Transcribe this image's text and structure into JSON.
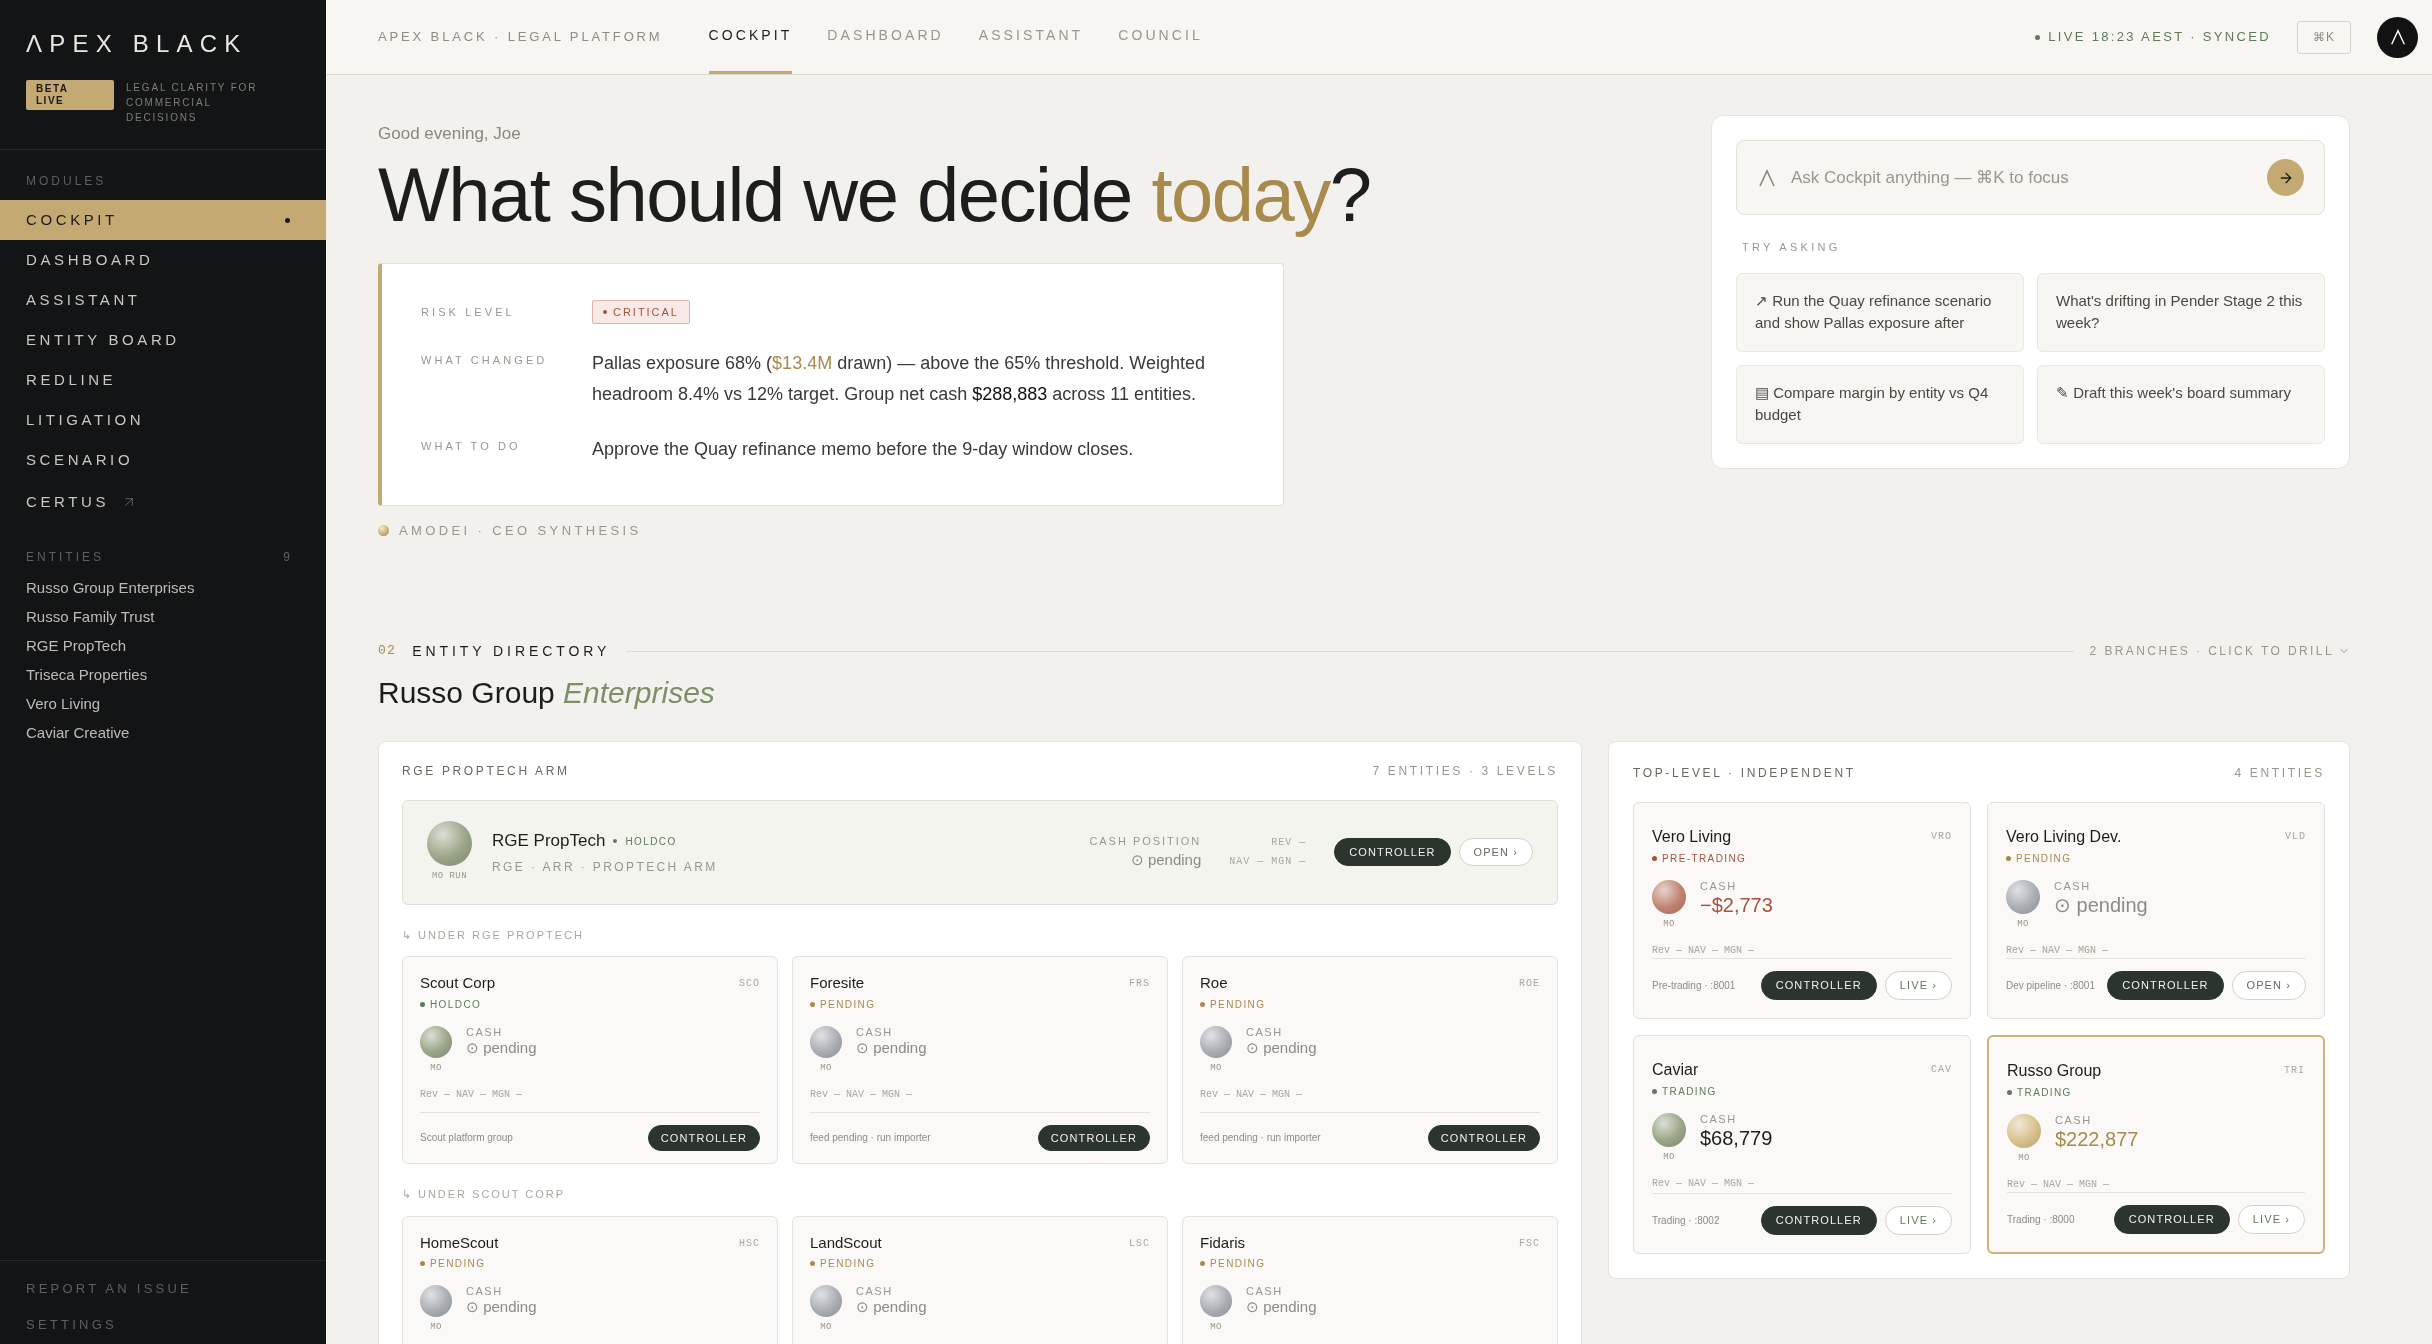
{
  "sidebar": {
    "logo": "ΛPEX BLACK",
    "badge": "BETA LIVE",
    "tagline": "LEGAL CLARITY FOR COMMERCIAL DECISIONS",
    "modules_label": "MODULES",
    "modules": [
      {
        "label": "COCKPIT",
        "selected": true,
        "external": false
      },
      {
        "label": "DASHBOARD",
        "selected": false,
        "external": false
      },
      {
        "label": "ASSISTANT",
        "selected": false,
        "external": false
      },
      {
        "label": "ENTITY BOARD",
        "selected": false,
        "external": false
      },
      {
        "label": "REDLINE",
        "selected": false,
        "external": false
      },
      {
        "label": "LITIGATION",
        "selected": false,
        "external": false
      },
      {
        "label": "SCENARIO",
        "selected": false,
        "external": false
      },
      {
        "label": "CERTUS",
        "selected": false,
        "external": true
      }
    ],
    "entities_label": "ENTITIES",
    "entities_count": "9",
    "entities": [
      "Russo Group Enterprises",
      "Russo Family Trust",
      "RGE PropTech",
      "Triseca Properties",
      "Vero Living",
      "Caviar Creative"
    ],
    "footer": [
      "REPORT AN ISSUE",
      "SETTINGS"
    ]
  },
  "topbar": {
    "crumb": "APEX BLACK · LEGAL PLATFORM",
    "tabs": [
      {
        "label": "COCKPIT",
        "selected": true
      },
      {
        "label": "DASHBOARD",
        "selected": false
      },
      {
        "label": "ASSISTANT",
        "selected": false
      },
      {
        "label": "COUNCIL",
        "selected": false
      }
    ],
    "status": "LIVE 18:23 AEST · SYNCED",
    "shortcut": "⌘K"
  },
  "hero": {
    "greeting": "Good evening, Joe",
    "title": "What should we decide ",
    "title_highlight": "today",
    "title_end": "?",
    "brief": [
      {
        "kind": "badge",
        "label": "RISK LEVEL",
        "badge": "CRITICAL"
      },
      {
        "kind": "text",
        "label": "WHAT CHANGED",
        "segments": [
          {
            "text": "Pallas exposure 68% (",
            "kind": "plain"
          },
          {
            "text": "$13.4M",
            "kind": "gold"
          },
          {
            "text": " drawn) — above the 65% threshold. Weighted headroom 8.4% vs 12% target. Group net cash ",
            "kind": "plain"
          },
          {
            "text": "$288,883",
            "kind": "strong"
          },
          {
            "text": " across 11 entities.",
            "kind": "plain"
          }
        ]
      },
      {
        "kind": "text",
        "label": "WHAT TO DO",
        "segments": [
          {
            "text": "Approve the Quay refinance memo before the 9-day window closes.",
            "kind": "plain"
          }
        ]
      }
    ],
    "source": "AMODEI · CEO SYNTHESIS"
  },
  "ask": {
    "placeholder": "Ask Cockpit anything — ⌘K to focus",
    "label": "TRY ASKING",
    "suggestions": [
      "↗ Run the Quay refinance scenario and show Pallas exposure after",
      "What's drifting in Pender Stage 2 this week?",
      "▤ Compare margin by entity vs Q4 budget",
      "✎ Draft this week's board summary"
    ]
  },
  "directory": {
    "index": "02",
    "title": "ENTITY DIRECTORY",
    "hint": "2 BRANCHES · CLICK TO DRILL",
    "heading": "Russo Group",
    "heading_accent": "Enterprises",
    "arm": {
      "title": "RGE PROPTECH ARM",
      "meta": "7 ENTITIES · 3 LEVELS",
      "root": {
        "name": "RGE PropTech",
        "status": {
          "label": "HOLDCO",
          "color": "#5f7a5b"
        },
        "sub": "RGE · ARR · PROPTECH ARM",
        "avatar": {
          "color": "#9aa487"
        },
        "avatar_label": "MO RUN",
        "cash_label": "CASH POSITION",
        "cash": "⊙ pending",
        "metrics": [
          "REV —",
          "NAV — MGN —"
        ],
        "buttons": [
          {
            "label": "CONTROLLER",
            "kind": "dark"
          },
          {
            "label": "OPEN ›",
            "kind": "plain"
          }
        ]
      },
      "groups": [
        {
          "label": "↳ UNDER RGE PROPTECH",
          "cards": [
            {
              "name": "Scout Corp",
              "code": "SCO",
              "status": {
                "label": "HOLDCO",
                "color": "#5f7a5b"
              },
              "avatar": {
                "color": "#9aa487"
              },
              "avatar_label": "MO",
              "cash_label": "CASH",
              "cash": {
                "value": "⊙ pending",
                "kind": "muted"
              },
              "metrics": "Rev — NAV — MGN —",
              "note": "Scout platform group",
              "buttons": [
                {
                  "label": "CONTROLLER",
                  "kind": "dark"
                }
              ],
              "selected": false
            },
            {
              "name": "Foresite",
              "code": "FRS",
              "status": {
                "label": "PENDING",
                "color": "#a88a4c"
              },
              "avatar": {
                "color": "#a9acb3"
              },
              "avatar_label": "MO",
              "cash_label": "CASH",
              "cash": {
                "value": "⊙ pending",
                "kind": "muted"
              },
              "metrics": "Rev — NAV — MGN —",
              "note": "feed pending · run importer",
              "buttons": [
                {
                  "label": "CONTROLLER",
                  "kind": "dark"
                }
              ],
              "selected": false
            },
            {
              "name": "Roe",
              "code": "ROE",
              "status": {
                "label": "PENDING",
                "color": "#a88a4c"
              },
              "avatar": {
                "color": "#a9acb3"
              },
              "avatar_label": "MO",
              "cash_label": "CASH",
              "cash": {
                "value": "⊙ pending",
                "kind": "muted"
              },
              "metrics": "Rev — NAV — MGN —",
              "note": "feed pending · run importer",
              "buttons": [
                {
                  "label": "CONTROLLER",
                  "kind": "dark"
                }
              ],
              "selected": false
            }
          ]
        },
        {
          "label": "↳ UNDER SCOUT CORP",
          "cards": [
            {
              "name": "HomeScout",
              "code": "HSC",
              "status": {
                "label": "PENDING",
                "color": "#a88a4c"
              },
              "avatar": {
                "color": "#a9acb3"
              },
              "avatar_label": "MO",
              "cash_label": "CASH",
              "cash": {
                "value": "⊙ pending",
                "kind": "muted"
              },
              "selected": false
            },
            {
              "name": "LandScout",
              "code": "LSC",
              "status": {
                "label": "PENDING",
                "color": "#a88a4c"
              },
              "avatar": {
                "color": "#a9acb3"
              },
              "avatar_label": "MO",
              "cash_label": "CASH",
              "cash": {
                "value": "⊙ pending",
                "kind": "muted"
              },
              "selected": false
            },
            {
              "name": "Fidaris",
              "code": "FSC",
              "status": {
                "label": "PENDING",
                "color": "#a88a4c"
              },
              "avatar": {
                "color": "#a9acb3"
              },
              "avatar_label": "MO",
              "cash_label": "CASH",
              "cash": {
                "value": "⊙ pending",
                "kind": "muted"
              },
              "selected": false
            }
          ]
        }
      ]
    },
    "independent": {
      "title": "TOP-LEVEL · INDEPENDENT",
      "meta": "4 ENTITIES",
      "cards": [
        {
          "name": "Vero Living",
          "code": "VRO",
          "status": {
            "label": "PRE-TRADING",
            "color": "#a5523f"
          },
          "avatar": {
            "color": "#bf8270"
          },
          "avatar_label": "MO",
          "cash_label": "CASH",
          "cash": {
            "value": "−$2,773",
            "kind": "negative"
          },
          "metrics": "Rev — NAV — MGN —",
          "note": "Pre-trading · :8001",
          "buttons": [
            {
              "label": "CONTROLLER",
              "kind": "dark"
            },
            {
              "label": "LIVE ›",
              "kind": "live"
            }
          ],
          "selected": false
        },
        {
          "name": "Vero Living Dev.",
          "code": "VLD",
          "status": {
            "label": "PENDING",
            "color": "#a88a4c"
          },
          "avatar": {
            "color": "#a9acb3"
          },
          "avatar_label": "MO",
          "cash_label": "CASH",
          "cash": {
            "value": "⊙ pending",
            "kind": "muted"
          },
          "metrics": "Rev — NAV — MGN —",
          "note": "Dev pipeline · :8001",
          "buttons": [
            {
              "label": "CONTROLLER",
              "kind": "dark"
            },
            {
              "label": "OPEN ›",
              "kind": "plain"
            }
          ],
          "selected": false
        },
        {
          "name": "Caviar",
          "code": "CAV",
          "status": {
            "label": "TRADING",
            "color": "#5f7a5b"
          },
          "avatar": {
            "color": "#9aa487"
          },
          "avatar_label": "MO",
          "cash_label": "CASH",
          "cash": {
            "value": "$68,779",
            "kind": "strong"
          },
          "metrics": "Rev — NAV — MGN —",
          "note": "Trading · :8002",
          "buttons": [
            {
              "label": "CONTROLLER",
              "kind": "dark"
            },
            {
              "label": "LIVE ›",
              "kind": "live"
            }
          ],
          "selected": false
        },
        {
          "name": "Russo Group",
          "code": "TRI",
          "status": {
            "label": "TRADING",
            "color": "#5f7a5b"
          },
          "avatar": {
            "color": "#d7c08a"
          },
          "avatar_label": "MO",
          "cash_label": "CASH",
          "cash": {
            "value": "$222,877",
            "kind": "gold"
          },
          "metrics": "Rev — NAV — MGN —",
          "note": "Trading · :8000",
          "buttons": [
            {
              "label": "CONTROLLER",
              "kind": "dark"
            },
            {
              "label": "LIVE ›",
              "kind": "live"
            }
          ],
          "selected": true
        }
      ]
    }
  }
}
